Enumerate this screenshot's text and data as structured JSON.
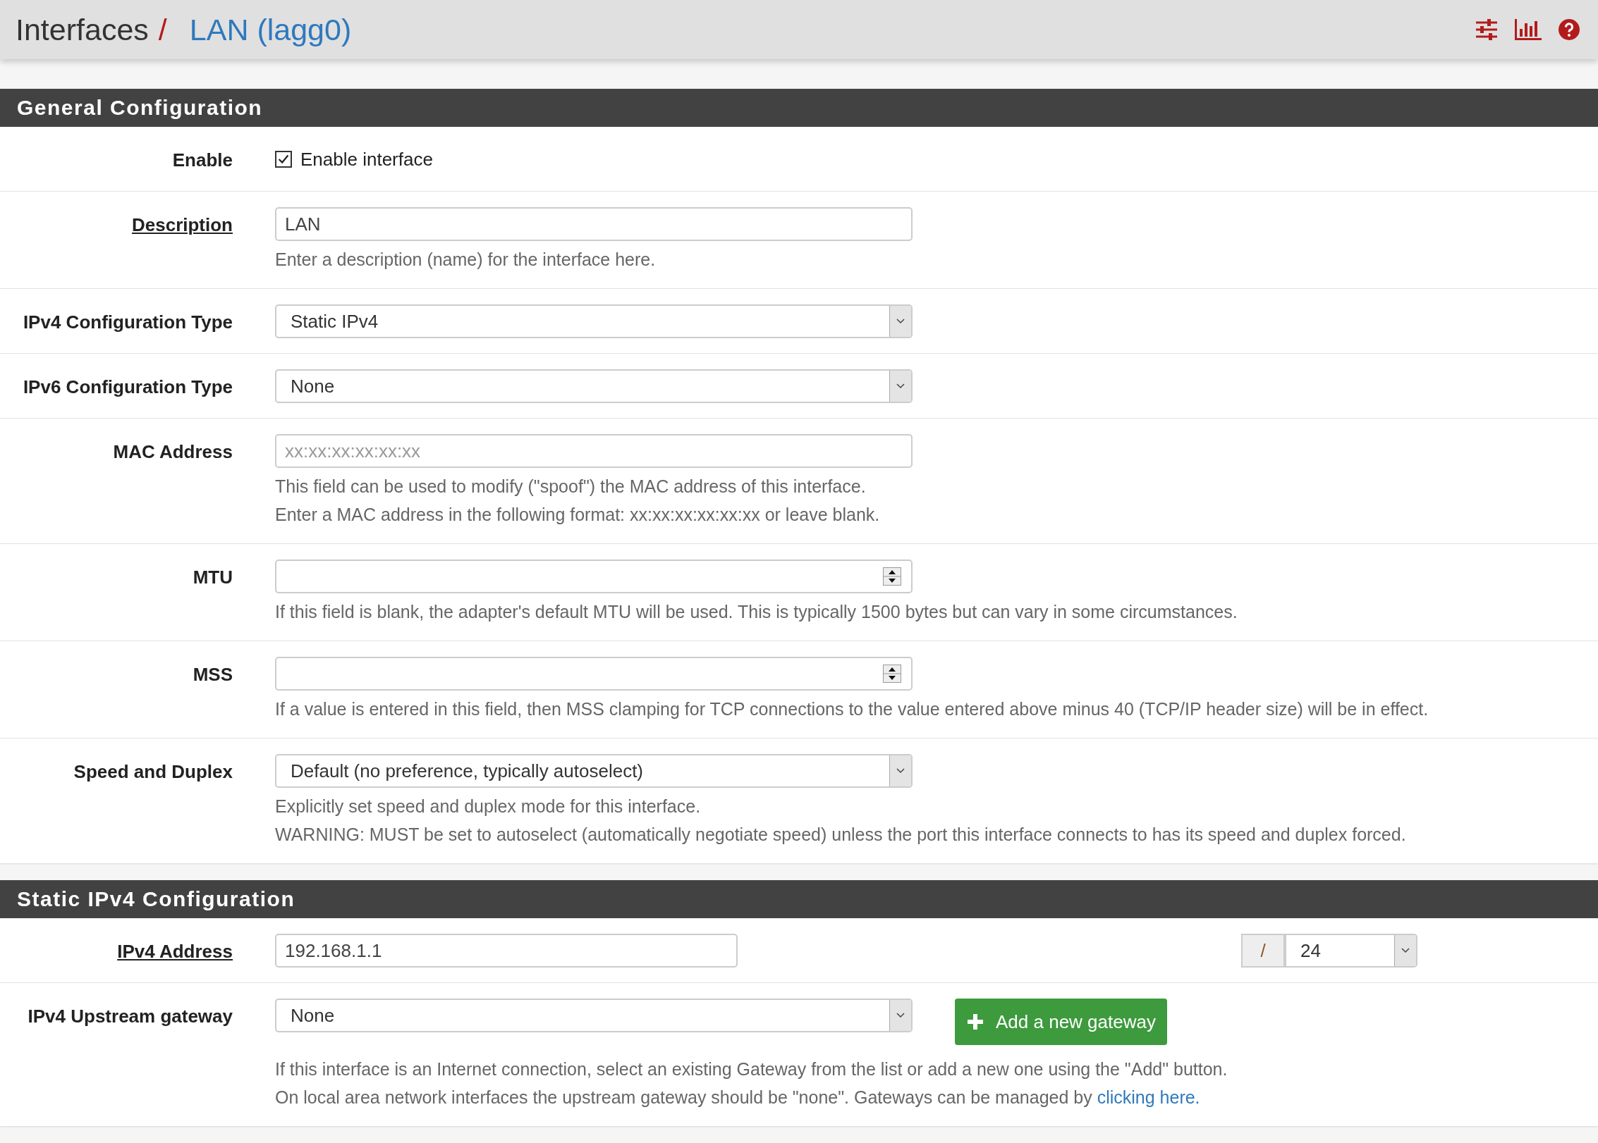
{
  "header": {
    "breadcrumb": "Interfaces",
    "separator": "/",
    "current": "LAN (lagg0)"
  },
  "sections": [
    {
      "title": "General Configuration",
      "rows": [
        {
          "kind": "checkbox",
          "label": "Enable",
          "label_link": false,
          "checked": true,
          "text": "Enable interface"
        },
        {
          "kind": "text",
          "label": "Description",
          "label_link": true,
          "value": "LAN",
          "help": [
            "Enter a description (name) for the interface here."
          ]
        },
        {
          "kind": "select",
          "label": "IPv4 Configuration Type",
          "label_link": false,
          "value": "Static IPv4"
        },
        {
          "kind": "select",
          "label": "IPv6 Configuration Type",
          "label_link": false,
          "value": "None"
        },
        {
          "kind": "text",
          "label": "MAC Address",
          "label_link": false,
          "placeholder": "xx:xx:xx:xx:xx:xx",
          "help": [
            "This field can be used to modify (\"spoof\") the MAC address of this interface.",
            "Enter a MAC address in the following format: xx:xx:xx:xx:xx:xx or leave blank."
          ]
        },
        {
          "kind": "number",
          "label": "MTU",
          "label_link": false,
          "help": [
            "If this field is blank, the adapter's default MTU will be used. This is typically 1500 bytes but can vary in some circumstances."
          ]
        },
        {
          "kind": "number",
          "label": "MSS",
          "label_link": false,
          "help": [
            "If a value is entered in this field, then MSS clamping for TCP connections to the value entered above minus 40 (TCP/IP header size) will be in effect."
          ]
        },
        {
          "kind": "select",
          "label": "Speed and Duplex",
          "label_link": false,
          "value": "Default (no preference, typically autoselect)",
          "help": [
            "Explicitly set speed and duplex mode for this interface.",
            "WARNING: MUST be set to autoselect (automatically negotiate speed) unless the port this interface connects to has its speed and duplex forced."
          ]
        }
      ]
    },
    {
      "title": "Static IPv4 Configuration",
      "rows": [
        {
          "kind": "ipv4",
          "label": "IPv4 Address",
          "label_link": true,
          "value": "192.168.1.1",
          "separator": "/",
          "cidr": "24"
        },
        {
          "kind": "gateway",
          "label": "IPv4 Upstream gateway",
          "label_link": false,
          "value": "None",
          "button": "Add a new gateway",
          "help": [
            "If this interface is an Internet connection, select an existing Gateway from the list or add a new one using the \"Add\" button.",
            "On local area network interfaces the upstream gateway should be \"none\". Gateways can be managed by"
          ],
          "help_link": "clicking here."
        }
      ]
    }
  ]
}
